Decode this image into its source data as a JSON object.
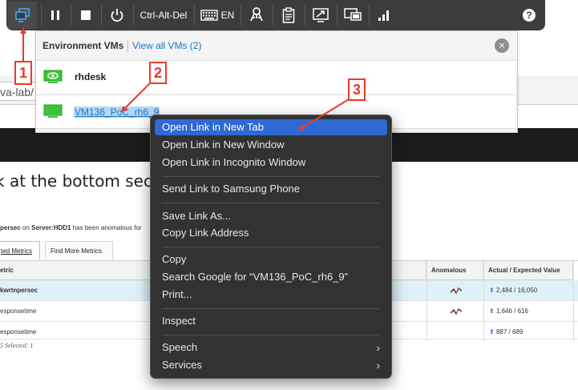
{
  "background_page": {
    "url_text": "va-lab/",
    "heading_text": "k at the bottom sect",
    "anomaly_note_bold": "persec",
    "anomaly_note_mid": " on ",
    "anomaly_note_server": "Server:HDD1",
    "anomaly_note_rest": " has been anomalous for",
    "tabs": [
      "ted Metrics",
      "Find More Metrics"
    ],
    "table": {
      "headers": [
        "etric",
        "Anomalous",
        "Actual / Expected Value"
      ],
      "rows": [
        {
          "metric": "kwrtnpersec",
          "value": "2,484 / 16,050",
          "anomalous": true,
          "selected": true
        },
        {
          "metric": "esponsetime",
          "value": "1,646 / 616",
          "anomalous": true,
          "selected": false
        },
        {
          "metric": "esponsetime",
          "value": "887 / 689",
          "anomalous": false,
          "selected": false
        }
      ],
      "footer": "5 Selected: 1"
    }
  },
  "toolbar": {
    "buttons": [
      {
        "name": "desktop-switcher-icon",
        "active": true
      },
      {
        "name": "pause-icon"
      },
      {
        "name": "stop-icon"
      },
      {
        "name": "power-icon"
      },
      {
        "name": "ctrl-alt-del",
        "label": "Ctrl-Alt-Del"
      },
      {
        "name": "keyboard-icon",
        "label": "EN"
      },
      {
        "name": "usb-keys-icon"
      },
      {
        "name": "clipboard-icon"
      },
      {
        "name": "resize-icon"
      },
      {
        "name": "multi-monitor-icon"
      },
      {
        "name": "signal-icon"
      },
      {
        "name": "help-icon"
      }
    ],
    "ctrl_alt_del_label": "Ctrl-Alt-Del",
    "keyboard_lang": "EN",
    "help_label": "?"
  },
  "vm_panel": {
    "title": "Environment VMs",
    "view_all_link": "View all VMs (2)",
    "close_label": "×",
    "vms": [
      {
        "name": "rhdesk"
      },
      {
        "name": "VM136_PoC_rh6_9"
      }
    ]
  },
  "context_menu": {
    "items": [
      {
        "label": "Open Link in New Tab",
        "highlighted": true
      },
      {
        "label": "Open Link in New Window"
      },
      {
        "label": "Open Link in Incognito Window"
      },
      {
        "label": "Send Link to Samsung Phone"
      },
      {
        "label": "Save Link As..."
      },
      {
        "label": "Copy Link Address"
      },
      {
        "label": "Copy"
      },
      {
        "label": "Search Google for “VM136_PoC_rh6_9”"
      },
      {
        "label": "Print..."
      },
      {
        "label": "Inspect"
      },
      {
        "label": "Speech",
        "submenu": true
      },
      {
        "label": "Services",
        "submenu": true
      }
    ],
    "submenu_arrow": "›"
  },
  "annotations": {
    "labels": [
      "1",
      "2",
      "3"
    ],
    "color": "#e83b2a"
  },
  "colors": {
    "toolbar_bg": "#3c3c3c",
    "menu_highlight": "#2f69d3",
    "vm_icon_green": "#3cc43c",
    "link_blue": "#1a73c6"
  }
}
